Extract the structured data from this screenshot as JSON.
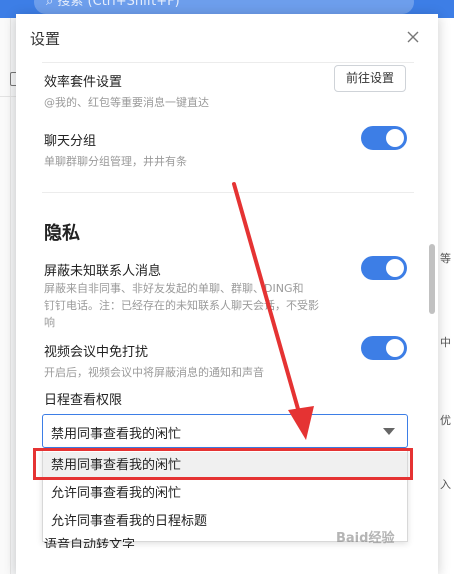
{
  "search": {
    "placeholder": "搜索 (Ctrl+Shift+F)"
  },
  "dialog": {
    "title": "设置"
  },
  "efficiency": {
    "title": "效率套件设置",
    "desc": "@我的、红包等重要消息一键直达",
    "button": "前往设置"
  },
  "chat_group": {
    "title": "聊天分组",
    "desc": "单聊群聊分组管理，井井有条",
    "enabled": true
  },
  "privacy": {
    "section_title": "隐私",
    "block_unknown": {
      "title": "屏蔽未知联系人消息",
      "desc_lines": [
        "屏蔽来自非同事、非好友发起的单聊、群聊、DING和",
        "钉钉电话。注：已经存在的未知联系人聊天会话，不受影",
        "响"
      ],
      "enabled": true
    },
    "video_dnd": {
      "title": "视频会议中免打扰",
      "desc": "开启后，视频会议中将屏蔽消息的通知和声音",
      "enabled": true
    },
    "schedule": {
      "title": "日程查看权限",
      "selected": "禁用同事查看我的闲忙",
      "options": [
        "禁用同事查看我的闲忙",
        "允许同事查看我的闲忙",
        "允许同事查看我的日程标题"
      ]
    },
    "next_item_partial": "语音自动转文字"
  },
  "background": {
    "side_texts": [
      "等",
      "中",
      "优",
      "入"
    ]
  },
  "watermark": "Baid经验",
  "colors": {
    "accent": "#3d7ee6",
    "annotation": "#e53333"
  }
}
